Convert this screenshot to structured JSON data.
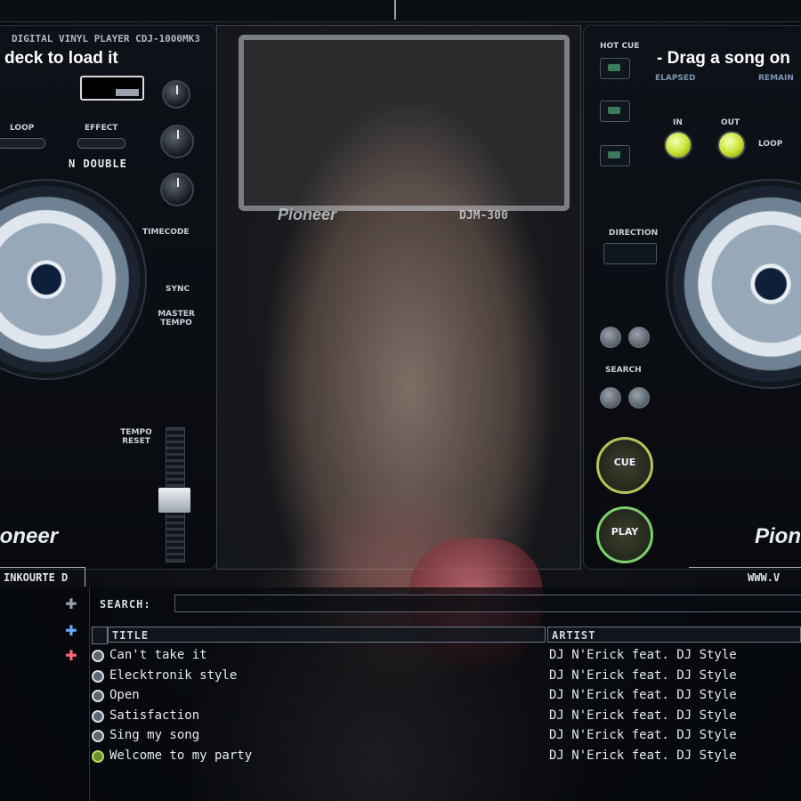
{
  "left_deck": {
    "model": "DIGITAL VINYL PLAYER CDJ-1000MK3",
    "message": "deck to load it",
    "loop_label": "LOOP",
    "effect_label": "EFFECT",
    "mode_label": "N  DOUBLE",
    "timecode_label": "TIMECODE",
    "sync_label": "SYNC",
    "master_tempo_label": "MASTER TEMPO",
    "tempo_reset_label": "TEMPO RESET",
    "brand": "Pioneer",
    "bottom_strip": "INKOURTE D"
  },
  "right_deck": {
    "message": "- Drag a song on",
    "elapsed_label": "ELAPSED",
    "remain_label": "REMAIN",
    "hot_cue_label": "HOT CUE",
    "in_label": "IN",
    "out_label": "OUT",
    "loop_label": "LOOP",
    "direction_label": "DIRECTION",
    "search_label": "SEARCH",
    "cue_label": "CUE",
    "play_label": "PLAY",
    "brand": "Pioneer",
    "bottom_strip": "WWW.V"
  },
  "mixer": {
    "brand": "Pioneer",
    "model": "DJM-300"
  },
  "browser": {
    "search_label": "SEARCH:",
    "search_value": "",
    "columns": [
      "TITLE",
      "ARTIST"
    ],
    "tracks": [
      {
        "title": "Can't take it",
        "artist": "DJ N'Erick feat. DJ Style",
        "icon": "disc-icon"
      },
      {
        "title": "Elecktronik style",
        "artist": "DJ N'Erick feat. DJ Style",
        "icon": "disc-icon"
      },
      {
        "title": "Open",
        "artist": "DJ N'Erick feat. DJ Style",
        "icon": "disc-icon"
      },
      {
        "title": "Satisfaction",
        "artist": "DJ N'Erick feat. DJ Style",
        "icon": "disc-icon"
      },
      {
        "title": "Sing my song",
        "artist": "DJ N'Erick feat. DJ Style",
        "icon": "disc-icon"
      },
      {
        "title": "Welcome to my party",
        "artist": "DJ N'Erick feat. DJ Style",
        "icon": "disc-green-icon"
      }
    ]
  }
}
